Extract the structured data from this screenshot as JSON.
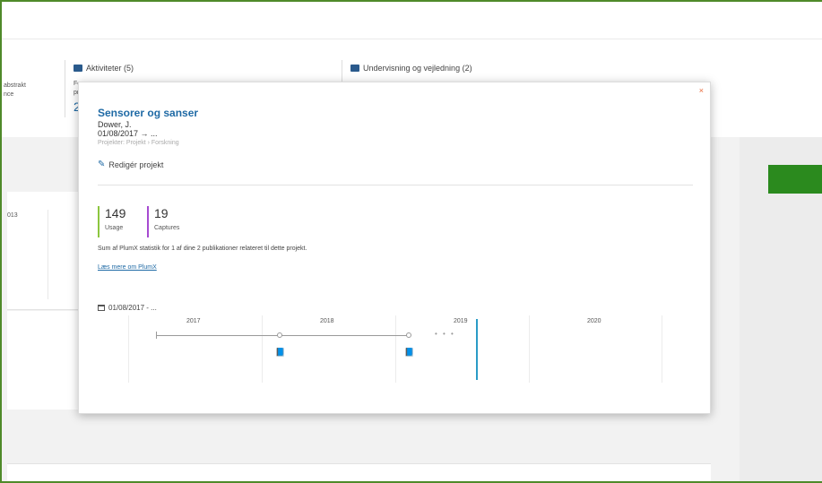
{
  "background": {
    "left_text_1": "abstrakt",
    "left_text_2": "nce",
    "activities_title": "Aktiviteter (5)",
    "activities_snippet_1": "Fo",
    "activities_snippet_2": "pr",
    "activities_count": "2",
    "teaching_title": "Undervisning og vejledning (2)",
    "card_year": "013"
  },
  "popup": {
    "close_label": "×",
    "title": "Sensorer og sanser",
    "author": "Dower, J.",
    "date": "01/08/2017 → ...",
    "type": "Projekter: Projekt › Forskning",
    "edit_label": "Redigér projekt",
    "usage": {
      "value": "149",
      "label": "Usage"
    },
    "captures": {
      "value": "19",
      "label": "Captures"
    },
    "summary": "Sum af PlumX statistik for 1 af dine 2 publikationer relateret til dette projekt.",
    "link": "Læs mere om PlumX",
    "range": "01/08/2017 - ...",
    "timeline": {
      "years": [
        "2017",
        "2018",
        "2019",
        "2020"
      ]
    }
  },
  "colors": {
    "accent_blue": "#1f6aa5",
    "usage_green": "#8cc63f",
    "captures_purple": "#a64ad1",
    "close_orange": "#e8693a",
    "frame_green": "#4f8a2a",
    "button_green": "#2b8a1e"
  },
  "icons": {
    "activities": "briefcase-icon",
    "teaching": "presentation-icon",
    "edit": "pencil-icon",
    "range": "calendar-icon",
    "timeline_item": "book-icon"
  }
}
